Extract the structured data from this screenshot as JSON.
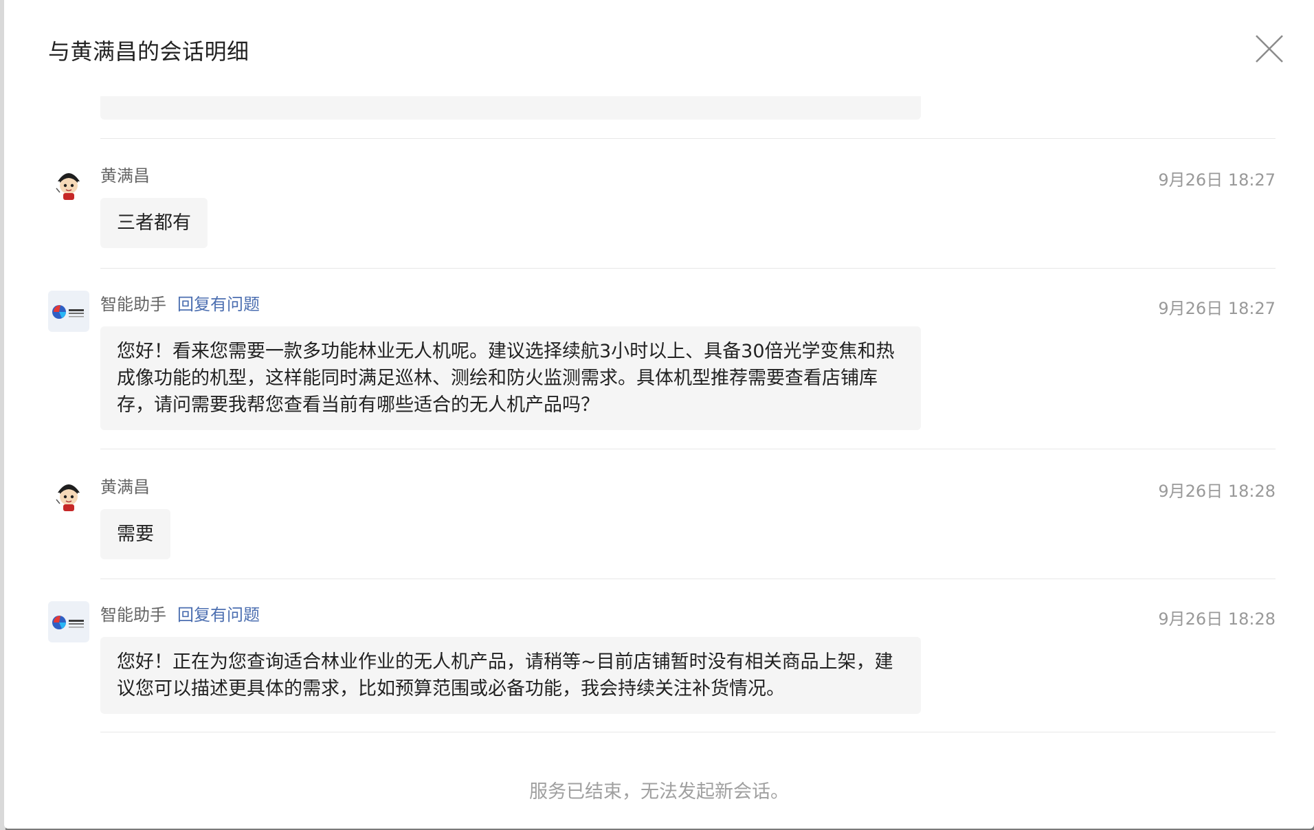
{
  "dialog": {
    "title": "与黄满昌的会话明细",
    "close_icon": "close-icon"
  },
  "messages": [
    {
      "sender": "黄满昌",
      "avatar_icon": "cartoon-avatar-icon",
      "time": "9月26日 18:27",
      "text": "三者都有"
    },
    {
      "sender": "智能助手",
      "avatar_icon": "bot-logo-icon",
      "report_label": "回复有问题",
      "time": "9月26日 18:27",
      "text": "您好！看来您需要一款多功能林业无人机呢。建议选择续航3小时以上、具备30倍光学变焦和热成像功能的机型，这样能同时满足巡林、测绘和防火监测需求。具体机型推荐需要查看店铺库存，请问需要我帮您查看当前有哪些适合的无人机产品吗？"
    },
    {
      "sender": "黄满昌",
      "avatar_icon": "cartoon-avatar-icon",
      "time": "9月26日 18:28",
      "text": "需要"
    },
    {
      "sender": "智能助手",
      "avatar_icon": "bot-logo-icon",
      "report_label": "回复有问题",
      "time": "9月26日 18:28",
      "text": "您好！正在为您查询适合林业作业的无人机产品，请稍等~目前店铺暂时没有相关商品上架，建议您可以描述更具体的需求，比如预算范围或必备功能，我会持续关注补货情况。"
    }
  ],
  "footer": {
    "notice": "服务已结束，无法发起新会话。"
  },
  "colors": {
    "bubble_bg": "#f5f5f5",
    "link": "#4b6eb0",
    "muted": "#999999"
  }
}
